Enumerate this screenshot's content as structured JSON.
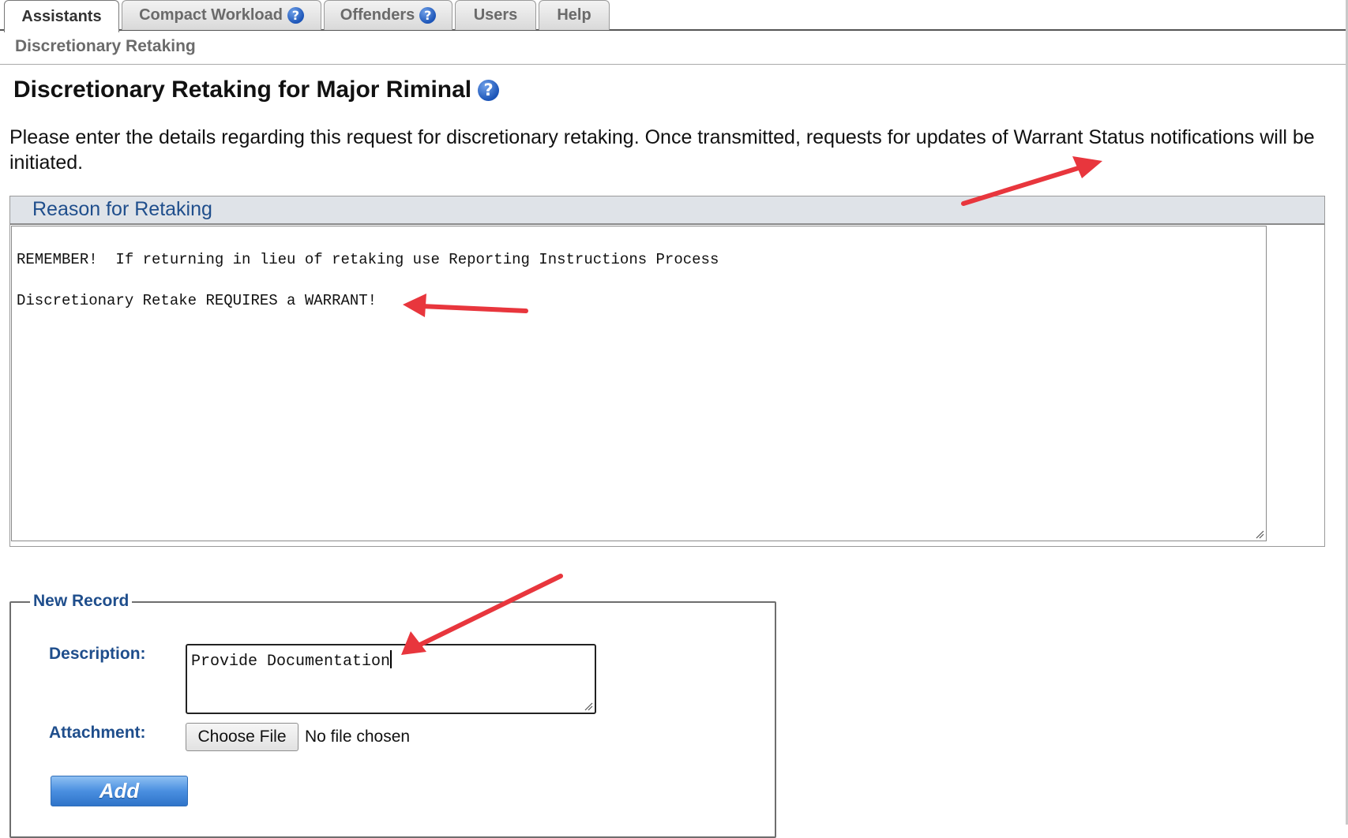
{
  "tabs": [
    {
      "label": "Assistants",
      "help": false,
      "active": true
    },
    {
      "label": "Compact Workload",
      "help": true,
      "active": false
    },
    {
      "label": "Offenders",
      "help": true,
      "active": false
    },
    {
      "label": "Users",
      "help": false,
      "active": false
    },
    {
      "label": "Help",
      "help": false,
      "active": false
    }
  ],
  "help_glyph": "?",
  "breadcrumb": "Discretionary Retaking",
  "page": {
    "title": "Discretionary Retaking for Major Riminal",
    "intro": "Please enter the details regarding this request for discretionary retaking. Once transmitted, requests for updates of Warrant Status notifications will be initiated."
  },
  "reason": {
    "header": "Reason for Retaking",
    "lines": [
      "REMEMBER!  If returning in lieu of retaking use Reporting Instructions Process",
      "Discretionary Retake REQUIRES a WARRANT!"
    ]
  },
  "new_record": {
    "legend": "New Record",
    "description_label": "Description:",
    "description_value": "Provide Documentation",
    "attachment_label": "Attachment:",
    "choose_file_label": "Choose File",
    "file_status": "No file chosen",
    "add_label": "Add"
  },
  "colors": {
    "accent_blue": "#1f4e8c",
    "annotation_red": "#e8363d",
    "panel_header": "#dfe3e8"
  },
  "icons": [
    "help-icon",
    "resize-grip-icon",
    "annotation-arrow"
  ]
}
